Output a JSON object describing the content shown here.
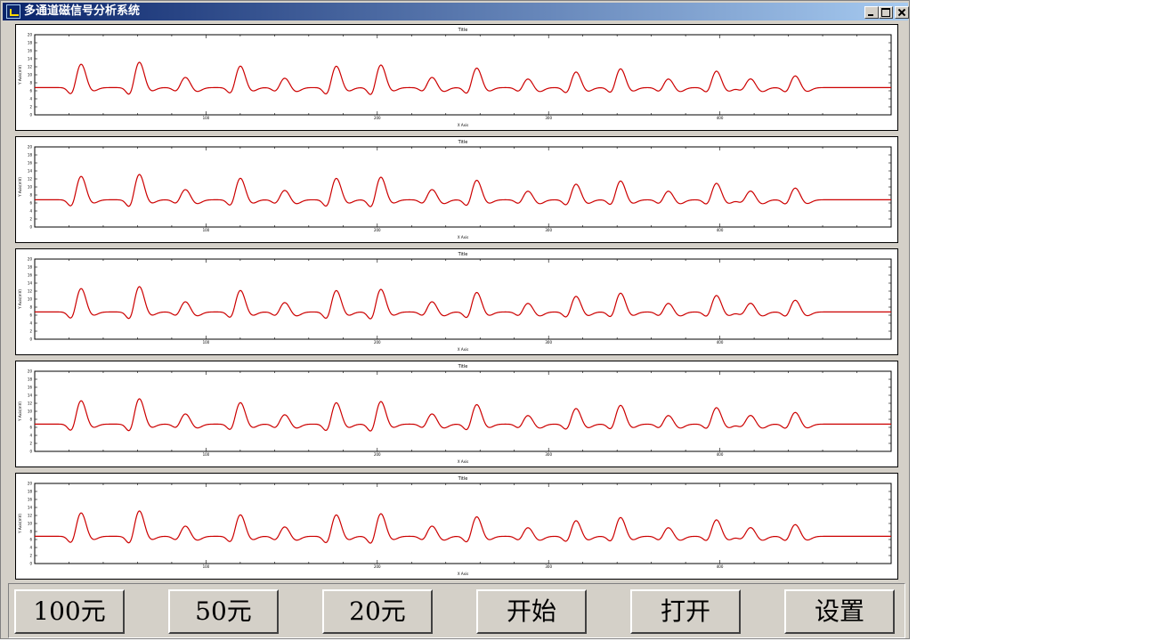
{
  "window": {
    "title": "多通道磁信号分析系统"
  },
  "buttons": [
    {
      "label": "100元"
    },
    {
      "label": "50元"
    },
    {
      "label": "20元"
    },
    {
      "label": "开始"
    },
    {
      "label": "打开"
    },
    {
      "label": "设置"
    }
  ],
  "charts": [
    {
      "title": "Title",
      "xlabel": "X Axis",
      "ylabel": "Y Axis(mV)",
      "yticks": [
        "0",
        "2",
        "4",
        "6",
        "8",
        "10",
        "12",
        "14",
        "16",
        "18",
        "20"
      ],
      "xticks": [
        "100",
        "200",
        "300",
        "400"
      ]
    },
    {
      "title": "Title",
      "xlabel": "X Axis",
      "ylabel": "Y Axis(mV)",
      "yticks": [
        "0",
        "2",
        "4",
        "6",
        "8",
        "10",
        "12",
        "14",
        "16",
        "18",
        "20"
      ],
      "xticks": [
        "100",
        "200",
        "300",
        "400"
      ]
    },
    {
      "title": "Title",
      "xlabel": "X Axis",
      "ylabel": "Y Axis(mV)",
      "yticks": [
        "0",
        "2",
        "4",
        "6",
        "8",
        "10",
        "12",
        "14",
        "16",
        "18",
        "20"
      ],
      "xticks": [
        "100",
        "200",
        "300",
        "400"
      ]
    },
    {
      "title": "Title",
      "xlabel": "X Axis",
      "ylabel": "Y Axis(mV)",
      "yticks": [
        "0",
        "2",
        "4",
        "6",
        "8",
        "10",
        "12",
        "14",
        "16",
        "18",
        "20"
      ],
      "xticks": [
        "100",
        "200",
        "300",
        "400"
      ]
    },
    {
      "title": "Title",
      "xlabel": "X Axis",
      "ylabel": "Y Axis(mV)",
      "yticks": [
        "0",
        "2",
        "4",
        "6",
        "8",
        "10",
        "12",
        "14",
        "16",
        "18",
        "20"
      ],
      "xticks": [
        "100",
        "200",
        "300",
        "400"
      ]
    }
  ],
  "chart_data": {
    "type": "line",
    "xlim": [
      0,
      500
    ],
    "ylim": [
      0,
      20
    ],
    "series_color": "#cc0000",
    "baseline": 6.8,
    "events": [
      {
        "x": 27,
        "dip": 4.2,
        "peak": 13.0
      },
      {
        "x": 61,
        "dip": 4.0,
        "peak": 13.5
      },
      {
        "x": 88,
        "dip": 5.5,
        "peak": 9.6
      },
      {
        "x": 120,
        "dip": 4.5,
        "peak": 12.5
      },
      {
        "x": 146,
        "dip": 5.5,
        "peak": 9.4
      },
      {
        "x": 176,
        "dip": 4.2,
        "peak": 12.5
      },
      {
        "x": 202,
        "dip": 4.0,
        "peak": 12.8
      },
      {
        "x": 232,
        "dip": 5.5,
        "peak": 9.6
      },
      {
        "x": 258,
        "dip": 4.5,
        "peak": 12.0
      },
      {
        "x": 288,
        "dip": 5.5,
        "peak": 9.2
      },
      {
        "x": 316,
        "dip": 4.8,
        "peak": 11.0
      },
      {
        "x": 342,
        "dip": 4.8,
        "peak": 11.8
      },
      {
        "x": 370,
        "dip": 5.5,
        "peak": 9.2
      },
      {
        "x": 398,
        "dip": 5.0,
        "peak": 11.2
      },
      {
        "x": 418,
        "dip": 5.8,
        "peak": 9.2
      },
      {
        "x": 444,
        "dip": 5.2,
        "peak": 10.0
      }
    ]
  },
  "colors": {
    "face": "#d4d0c8",
    "title_start": "#0a246a",
    "title_end": "#a6caf0",
    "plot_line": "#cc0000"
  }
}
